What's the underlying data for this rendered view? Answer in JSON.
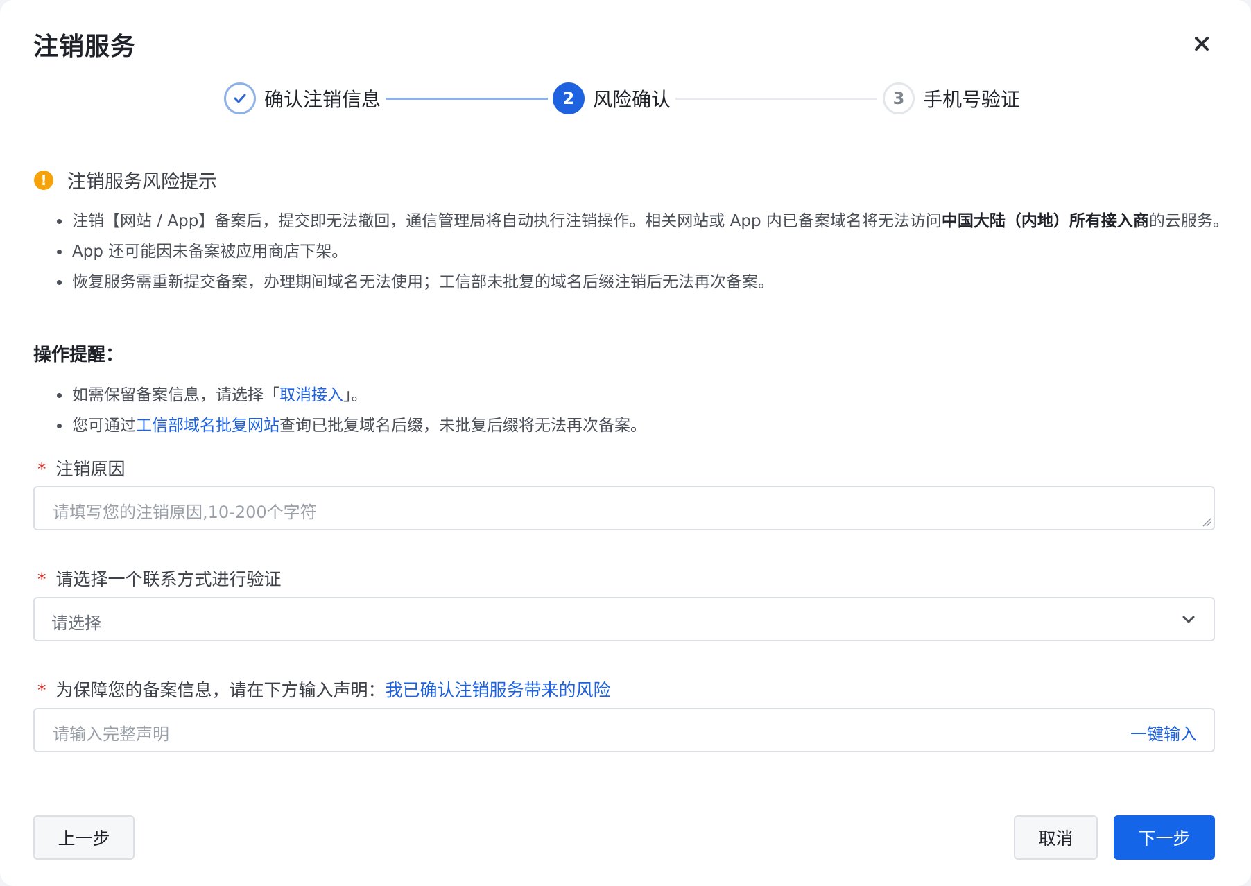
{
  "dialog": {
    "title": "注销服务"
  },
  "stepper": {
    "steps": [
      {
        "number": "1",
        "label": "确认注销信息",
        "state": "done"
      },
      {
        "number": "2",
        "label": "风险确认",
        "state": "active"
      },
      {
        "number": "3",
        "label": "手机号验证",
        "state": "pending"
      }
    ]
  },
  "warning": {
    "title": "注销服务风险提示",
    "items": {
      "item1_a": "注销【网站 / App】备案后，提交即无法撤回，通信管理局将自动执行注销操作。相关网站或 App 内已备案域名将无法访问",
      "item1_strong": "中国大陆（内地）所有接入商",
      "item1_b": "的云服务。",
      "item2": "App 还可能因未备案被应用商店下架。",
      "item3": "恢复服务需重新提交备案，办理期间域名无法使用；工信部未批复的域名后缀注销后无法再次备案。"
    }
  },
  "operations": {
    "title": "操作提醒：",
    "item1_a": "如需保留备案信息，请选择「",
    "item1_link": "取消接入",
    "item1_b": "」。",
    "item2_a": "您可通过",
    "item2_link": "工信部域名批复网站",
    "item2_b": "查询已批复域名后缀，未批复后缀将无法再次备案。"
  },
  "form": {
    "required_mark": "*",
    "reason": {
      "label": "注销原因",
      "placeholder": "请填写您的注销原因,10-200个字符",
      "value": ""
    },
    "contact": {
      "label": "请选择一个联系方式进行验证",
      "selected": "请选择"
    },
    "declaration": {
      "label": "为保障您的备案信息，请在下方输入声明：",
      "statement": "我已确认注销服务带来的风险",
      "placeholder": "请输入完整声明",
      "value": "",
      "quick_input": "一键输入"
    }
  },
  "footer": {
    "prev_label": "上一步",
    "cancel_label": "取消",
    "next_label": "下一步"
  },
  "colors": {
    "primary": "#1565e8",
    "link": "#1e62e0",
    "warning": "#f6a20a",
    "required": "#d93026"
  },
  "icons": {
    "close": "close-icon",
    "step_done": "check-icon",
    "warning": "exclamation-icon",
    "select": "chevron-down-icon"
  }
}
